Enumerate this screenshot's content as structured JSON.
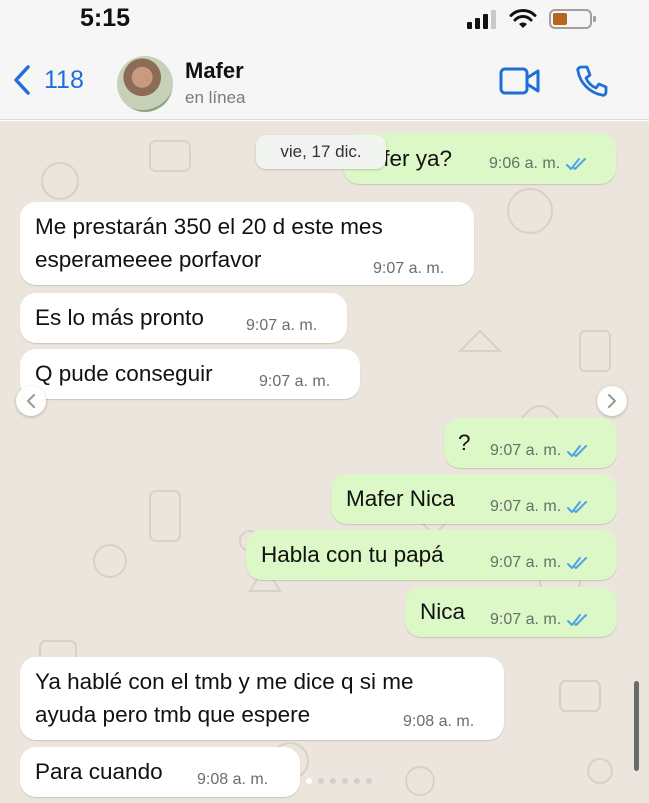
{
  "status_bar": {
    "time": "5:15"
  },
  "header": {
    "back_count": "118",
    "contact_name": "Mafer",
    "contact_status": "en línea"
  },
  "date_chip": "vie, 17 dic.",
  "messages": [
    {
      "text": "Mafer ya?",
      "time": "9:06 a. m.",
      "direction": "out",
      "read": true,
      "partially_hidden": true
    },
    {
      "text_lines": [
        "Me prestarán 350 el 20 d este mes",
        "esperameeee porfavor"
      ],
      "time": "9:07 a. m.",
      "direction": "in"
    },
    {
      "text": "Es lo más pronto",
      "time": "9:07 a. m.",
      "direction": "in"
    },
    {
      "text": "Q pude conseguir",
      "time": "9:07 a. m.",
      "direction": "in"
    },
    {
      "text": "?",
      "time": "9:07 a. m.",
      "direction": "out",
      "read": true
    },
    {
      "text": "Mafer Nica",
      "time": "9:07 a. m.",
      "direction": "out",
      "read": true
    },
    {
      "text": "Habla con tu papá",
      "time": "9:07 a. m.",
      "direction": "out",
      "read": true
    },
    {
      "text": "Nica",
      "time": "9:07 a. m.",
      "direction": "out",
      "read": true
    },
    {
      "text_lines": [
        "Ya hablé con el tmb y me dice q si me",
        "ayuda pero tmb que espere"
      ],
      "time": "9:08 a. m.",
      "direction": "in"
    },
    {
      "text": "Para cuando",
      "time": "9:08 a. m.",
      "direction": "in"
    }
  ],
  "colors": {
    "accent": "#1f6fd6",
    "outgoing_bubble": "#dcf8c6",
    "incoming_bubble": "#ffffff",
    "read_ticks": "#4fa3e6",
    "chat_background": "#ece5dd"
  },
  "icons": [
    "signal-icon",
    "wifi-icon",
    "battery-icon",
    "back-chevron-icon",
    "video-call-icon",
    "phone-call-icon",
    "double-check-icon"
  ]
}
